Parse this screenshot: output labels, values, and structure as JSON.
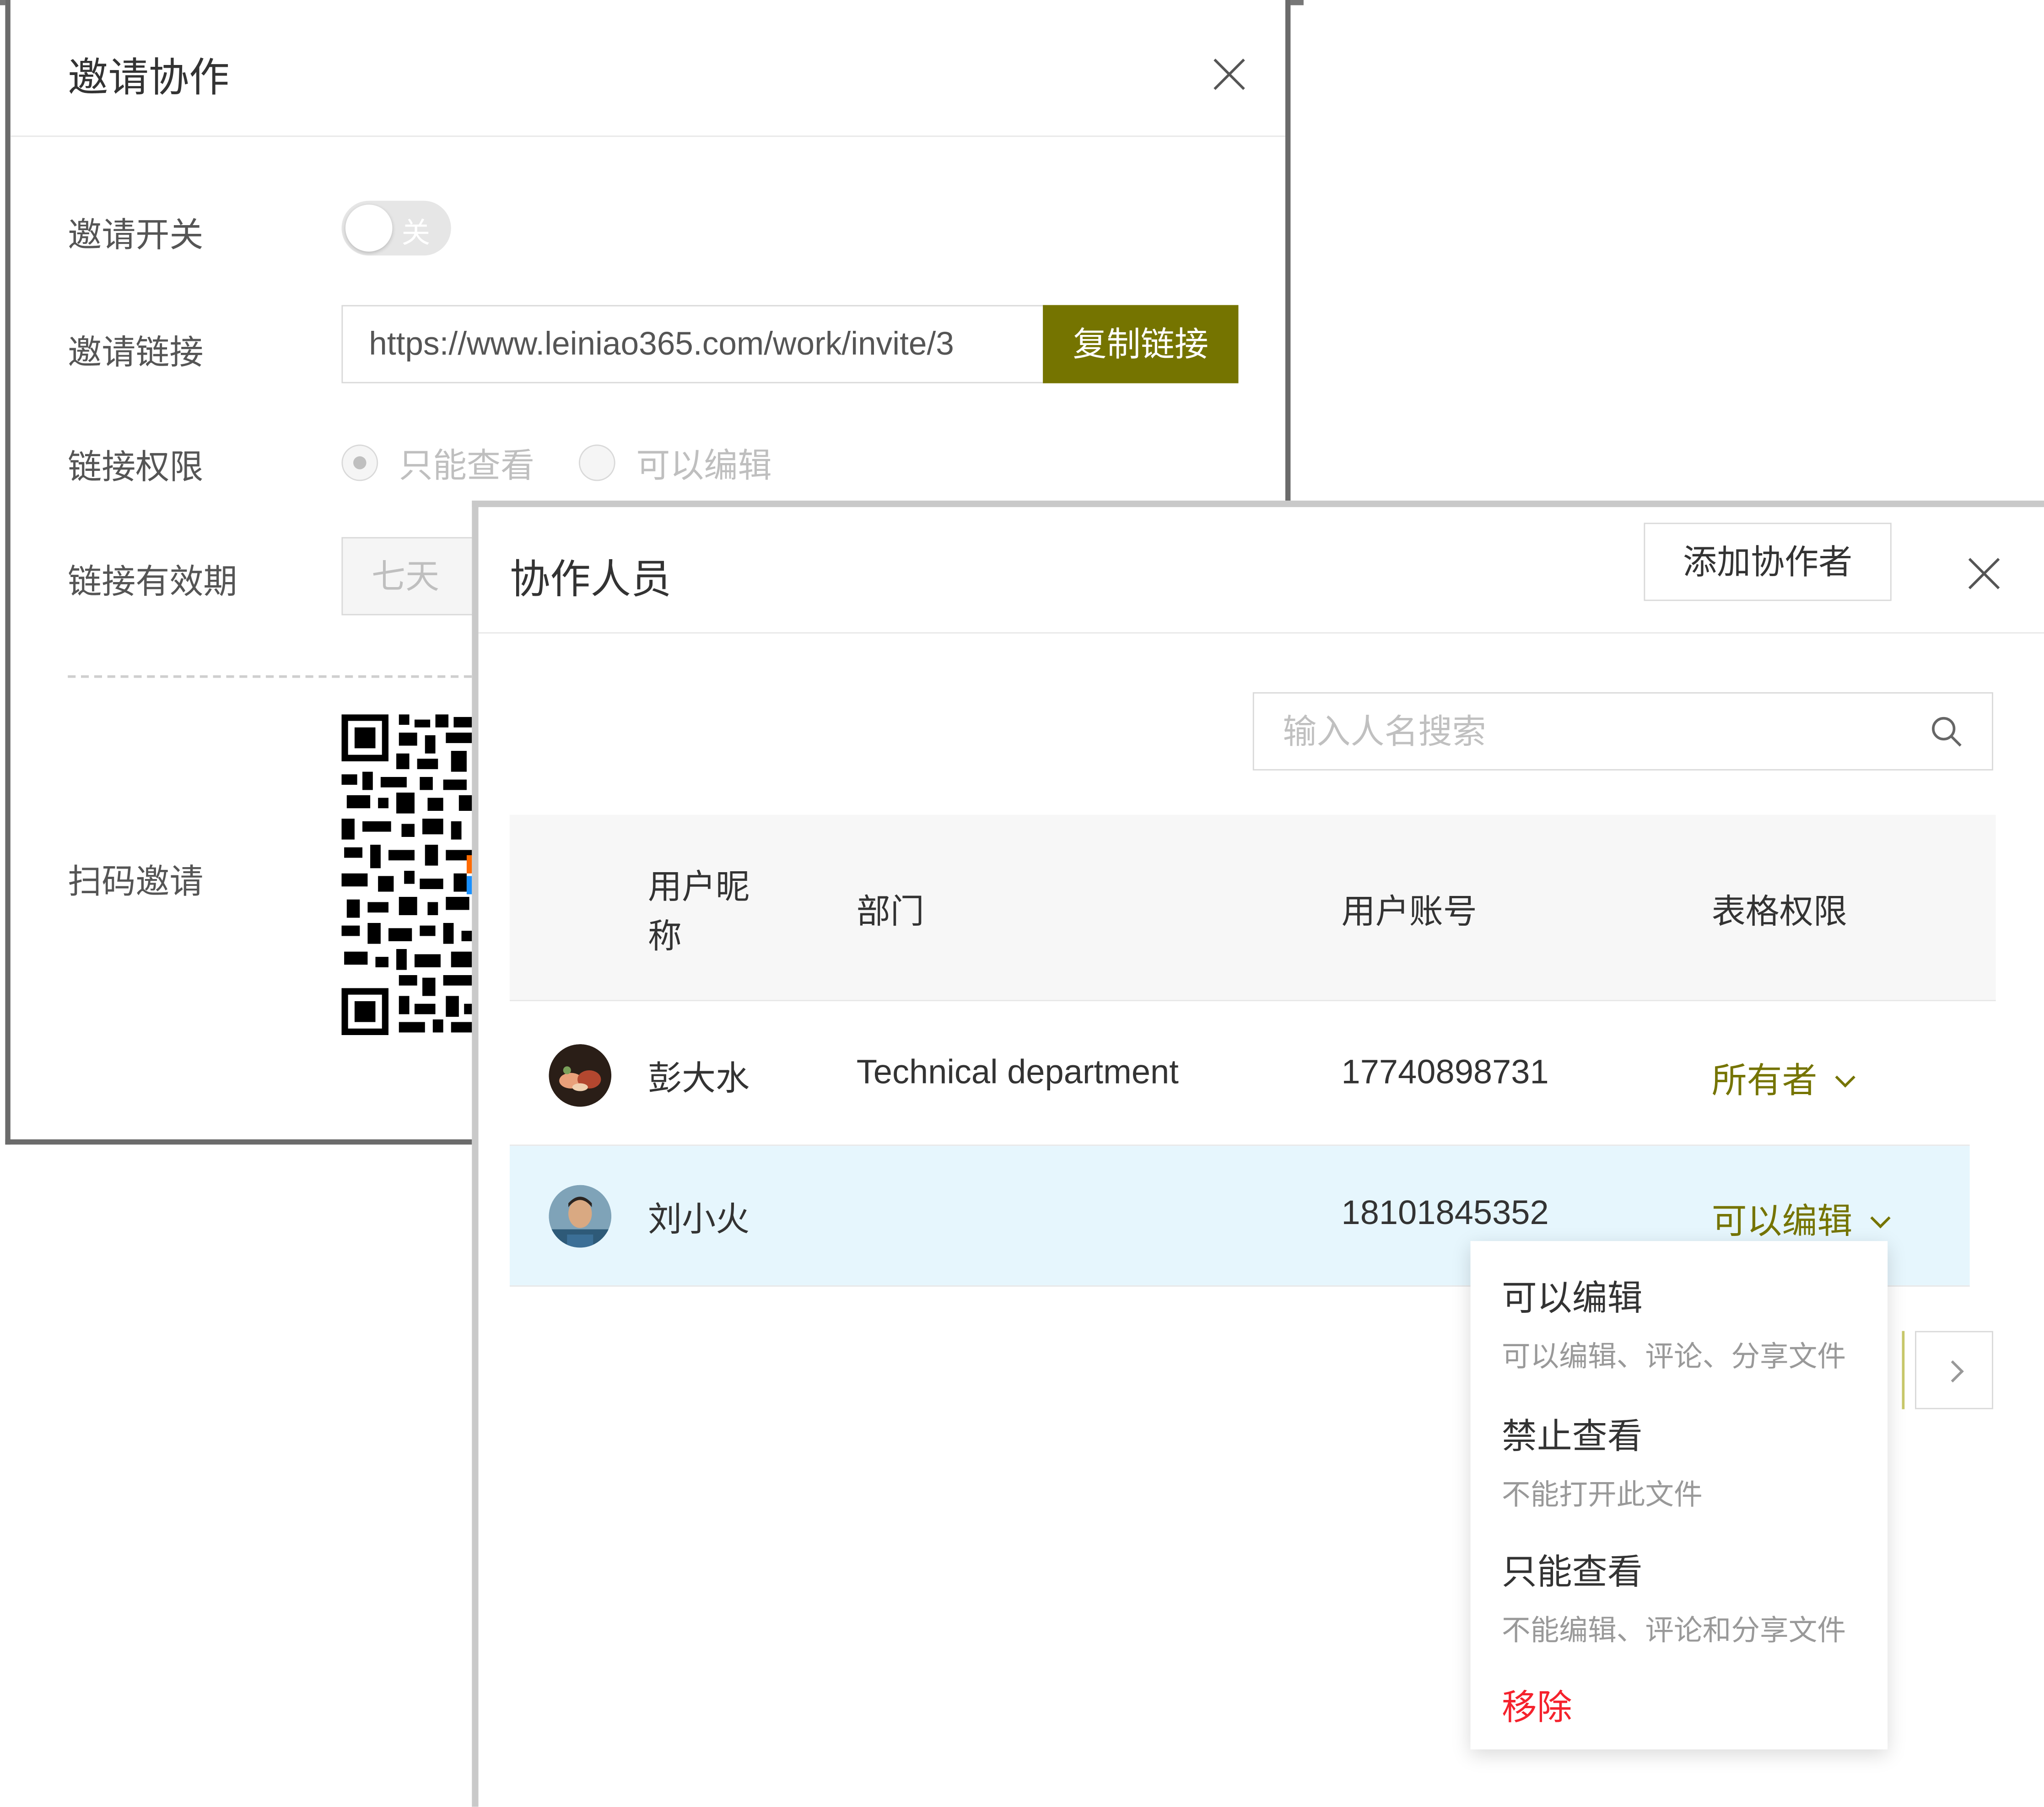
{
  "invite_dialog": {
    "title": "邀请协作",
    "toggle": {
      "label": "邀请开关",
      "state_text": "关"
    },
    "link": {
      "label": "邀请链接",
      "url": "https://www.leiniao365.com/work/invite/3",
      "copy_button": "复制链接"
    },
    "permission": {
      "label": "链接权限",
      "options": [
        "只能查看",
        "可以编辑"
      ],
      "selected": "只能查看"
    },
    "expiry": {
      "label": "链接有效期",
      "value": "七天"
    },
    "qr": {
      "label": "扫码邀请"
    }
  },
  "collab_dialog": {
    "title": "协作人员",
    "add_button": "添加协作者",
    "search": {
      "placeholder": "输入人名搜索"
    },
    "table": {
      "columns": [
        "用户昵称",
        "部门",
        "用户账号",
        "表格权限"
      ],
      "rows": [
        {
          "name": "彭大水",
          "department": "Technical department",
          "account": "17740898731",
          "permission": "所有者"
        },
        {
          "name": "刘小火",
          "department": "",
          "account": "18101845352",
          "permission": "可以编辑"
        }
      ]
    },
    "dropdown": {
      "items": [
        {
          "title": "可以编辑",
          "desc": "可以编辑、评论、分享文件"
        },
        {
          "title": "禁止查看",
          "desc": "不能打开此文件"
        },
        {
          "title": "只能查看",
          "desc": "不能编辑、评论和分享文件"
        }
      ],
      "remove": "移除"
    }
  },
  "colors": {
    "accent": "#757400",
    "danger": "#f5222d",
    "selected_row": "#e6f6fd"
  }
}
